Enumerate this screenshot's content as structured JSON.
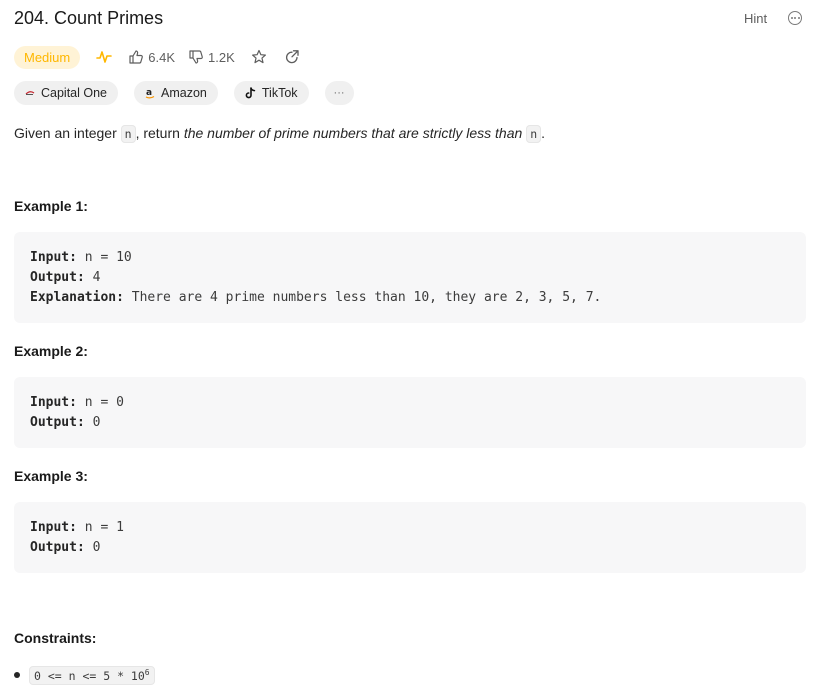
{
  "problem": {
    "title": "204. Count Primes",
    "hint_label": "Hint",
    "difficulty": "Medium",
    "likes": "6.4K",
    "dislikes": "1.2K"
  },
  "companies": [
    {
      "name": "Capital One",
      "icon": "capital-one-logo"
    },
    {
      "name": "Amazon",
      "icon": "amazon-logo"
    },
    {
      "name": "TikTok",
      "icon": "tiktok-logo"
    }
  ],
  "more_tags_label": "···",
  "description": {
    "prefix": "Given an integer ",
    "var1": "n",
    "middle": ", return ",
    "emphasis": "the number of prime numbers that are strictly less than",
    "space": " ",
    "var2": "n",
    "suffix": "."
  },
  "examples": [
    {
      "title": "Example 1:",
      "input_label": "Input:",
      "input_value": " n = 10",
      "output_label": "Output:",
      "output_value": " 4",
      "explanation_label": "Explanation:",
      "explanation_value": " There are 4 prime numbers less than 10, they are 2, 3, 5, 7."
    },
    {
      "title": "Example 2:",
      "input_label": "Input:",
      "input_value": " n = 0",
      "output_label": "Output:",
      "output_value": " 0"
    },
    {
      "title": "Example 3:",
      "input_label": "Input:",
      "input_value": " n = 1",
      "output_label": "Output:",
      "output_value": " 0"
    }
  ],
  "constraints": {
    "title": "Constraints:",
    "items": [
      {
        "text": "0 <= n <= 5 * 10",
        "sup": "6"
      }
    ]
  },
  "colors": {
    "medium_text": "#ffb700",
    "medium_bg": "#fff3d6",
    "code_block_bg": "#f7f7f8"
  }
}
